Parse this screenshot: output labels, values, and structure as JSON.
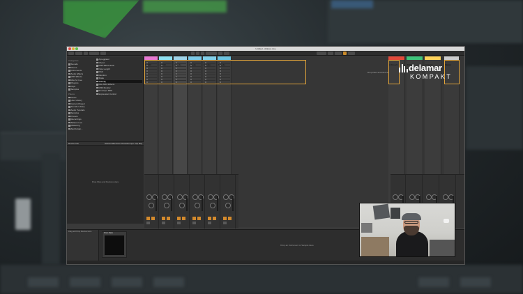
{
  "window": {
    "title": "Untitled - Ableton Live"
  },
  "browser": {
    "categories_label": "Categories",
    "categories": [
      "Sounds",
      "Drums",
      "Instruments",
      "Audio Effects",
      "MIDI Effects",
      "Max for Live",
      "Plug-Ins",
      "Clips",
      "Samples"
    ],
    "places_label": "Places",
    "places": [
      "Packs",
      "User Library",
      "Current Project",
      "Sounds Library",
      "Audio Tutorials",
      "Samples",
      "Presets",
      "Recordings",
      "Ableton Live",
      "Mastering",
      "Add Folder..."
    ],
    "items": [
      "Arpeggiator",
      "Chord",
      "MIDI Effect Rack",
      "Note Length",
      "Pitch",
      "Random",
      "Scale",
      "Velocity",
      "Max MIDI Effects",
      "MIDI Monitor",
      "Envelope MIDI",
      "Expression Control"
    ],
    "selected_item": "Velocity"
  },
  "info": {
    "headers": [
      "Device Info",
      "Sessions",
      "Devices Preset",
      "Groups",
      "Clip Bay"
    ],
    "hint": "Drop Files and Devices Here"
  },
  "session": {
    "tracks": [
      {
        "name": "1 MIDI",
        "color": "#e879d2"
      },
      {
        "name": "2 MIDI",
        "color": "#8fe0f0"
      },
      {
        "name": "3 Audio",
        "color": "#9fd3e8"
      },
      {
        "name": "4 Audio",
        "color": "#7cc9e6"
      },
      {
        "name": "5 Audio",
        "color": "#82cfe8"
      },
      {
        "name": "6 Audio",
        "color": "#6cc3df"
      }
    ],
    "returns": [
      {
        "name": "A Reverb",
        "color": "#e34a3a"
      },
      {
        "name": "B Delay",
        "color": "#3ec47a"
      },
      {
        "name": "C Send",
        "color": "#ffd25a"
      }
    ],
    "master_label": "Master",
    "drop_hint": "Drop Files and Devices Here"
  },
  "dock": {
    "device_info": "Drag and Drop Devices Here",
    "device_name": "Drum Rack",
    "drop_hint": "Drop an Instrument or Sample Here"
  },
  "logo": {
    "name": "delamar",
    "sub": "KOMPAKT"
  },
  "colors": {
    "selection": "#e0a33a",
    "accent": "#d2892c"
  }
}
